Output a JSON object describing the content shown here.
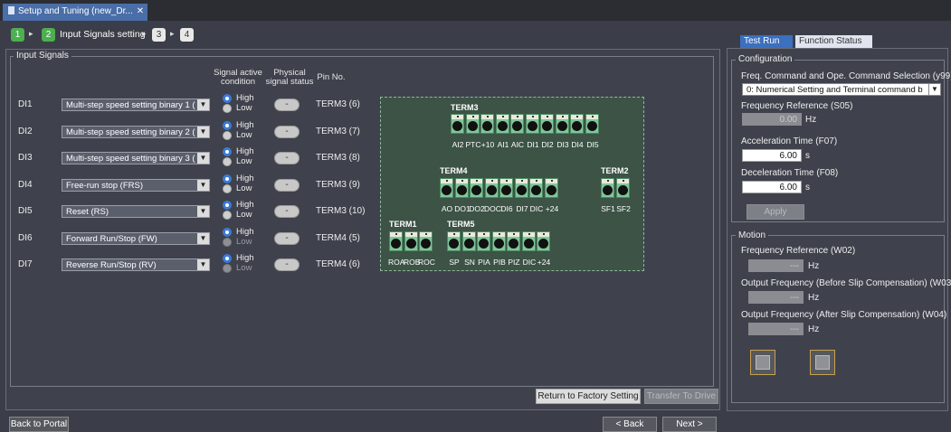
{
  "window": {
    "tab_title": "Setup and Tuning (new_Dr...",
    "close": "✕"
  },
  "steps": {
    "s1": "1",
    "s2": "2",
    "current_label": "Input Signals setting",
    "s3": "3",
    "s4": "4",
    "arrow": "▸"
  },
  "input_signals": {
    "legend": "Input Signals",
    "headers": {
      "active_1": "Signal active",
      "active_2": "condition",
      "phys_1": "Physical",
      "phys_2": "signal status",
      "pin": "Pin No."
    },
    "rows": [
      {
        "di": "DI1",
        "func": "Multi-step speed setting binary 1 (",
        "high": "High",
        "low": "Low",
        "status": "-",
        "pin": "TERM3 (6)"
      },
      {
        "di": "DI2",
        "func": "Multi-step speed setting binary 2 (",
        "high": "High",
        "low": "Low",
        "status": "-",
        "pin": "TERM3 (7)"
      },
      {
        "di": "DI3",
        "func": "Multi-step speed setting binary 3 (",
        "high": "High",
        "low": "Low",
        "status": "-",
        "pin": "TERM3 (8)"
      },
      {
        "di": "DI4",
        "func": "Free-run stop (FRS)",
        "high": "High",
        "low": "Low",
        "status": "-",
        "pin": "TERM3 (9)"
      },
      {
        "di": "DI5",
        "func": "Reset (RS)",
        "high": "High",
        "low": "Low",
        "status": "-",
        "pin": "TERM3 (10)"
      },
      {
        "di": "DI6",
        "func": "Forward Run/Stop (FW)",
        "high": "High",
        "low": "Low",
        "status": "-",
        "pin": "TERM4 (5)"
      },
      {
        "di": "DI7",
        "func": "Reverse Run/Stop (RV)",
        "high": "High",
        "low": "Low",
        "status": "-",
        "pin": "TERM4 (6)"
      }
    ]
  },
  "terminals": {
    "term3": {
      "name": "TERM3",
      "pins": [
        "AI2",
        "PTC",
        "+10",
        "AI1",
        "AIC",
        "DI1",
        "DI2",
        "DI3",
        "DI4",
        "DI5"
      ]
    },
    "term4": {
      "name": "TERM4",
      "pins": [
        "AO",
        "DO1",
        "DO2",
        "DOC",
        "DI6",
        "DI7",
        "DIC",
        "+24"
      ]
    },
    "term2": {
      "name": "TERM2",
      "pins": [
        "SF1",
        "SF2"
      ]
    },
    "term1": {
      "name": "TERM1",
      "pins": [
        "ROA",
        "ROB",
        "ROC"
      ]
    },
    "term5": {
      "name": "TERM5",
      "pins": [
        "SP",
        "SN",
        "PIA",
        "PIB",
        "PIZ",
        "DIC",
        "+24"
      ]
    }
  },
  "buttons": {
    "factory": "Return to Factory Setting",
    "transfer": "Transfer To Drive",
    "back_portal": "Back to Portal",
    "back": "< Back",
    "next": "Next >"
  },
  "right_panel": {
    "tab_test_run": "Test Run",
    "tab_function_status": "Function Status",
    "config_legend": "Configuration",
    "freq_cmd_label": "Freq. Command and Ope. Command Selection (y99)",
    "freq_cmd_value": "0: Numerical Setting and Terminal command b",
    "freq_ref_label": "Frequency Reference (S05)",
    "freq_ref_value": "0.00",
    "hz": "Hz",
    "accel_label": "Acceleration Time (F07)",
    "accel_value": "6.00",
    "sec": "s",
    "decel_label": "Deceleration Time (F08)",
    "decel_value": "6.00",
    "apply": "Apply",
    "motion_legend": "Motion",
    "w02_label": "Frequency Reference (W02)",
    "w03_label": "Output Frequency (Before Slip Compensation) (W03)",
    "w04_label": "Output Frequency (After Slip Compensation) (W04)",
    "dash": "---"
  },
  "colors": {
    "accent": "#4caf50",
    "tab_blue": "#3b6fbf",
    "terminal_green": "#7fc79a"
  }
}
